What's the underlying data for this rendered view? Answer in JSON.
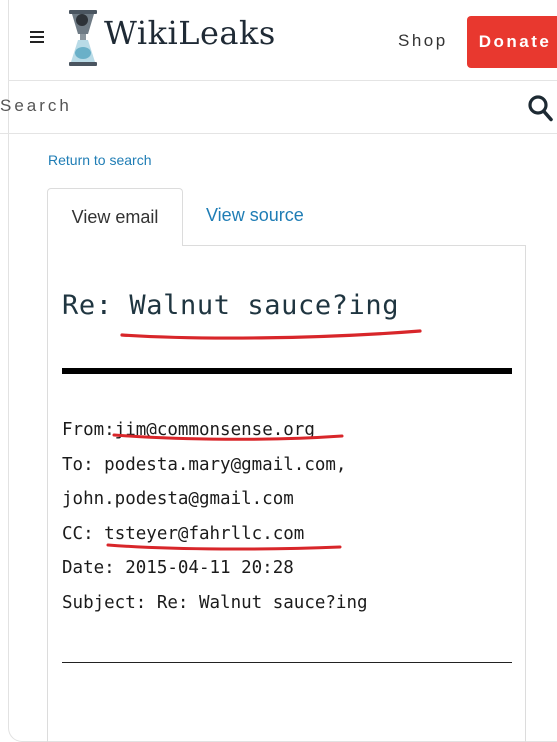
{
  "header": {
    "site_title": "WikiLeaks",
    "shop_label": "Shop",
    "donate_label": "Donate"
  },
  "search": {
    "placeholder": "Search"
  },
  "return_link": "Return to search",
  "tabs": [
    {
      "label": "View email",
      "active": true
    },
    {
      "label": "View source",
      "active": false
    }
  ],
  "email": {
    "title": "Re: Walnut sauce?ing",
    "from_label": "From:",
    "from_value": "jim@commonsense.org",
    "to_line_1": "To: podesta.mary@gmail.com,",
    "to_line_2": "john.podesta@gmail.com",
    "cc_label": "CC: ",
    "cc_value": "tsteyer@fahrllc.com",
    "date_line": "Date: 2015-04-11 20:28",
    "subject_line": "Subject: Re: Walnut sauce?ing"
  },
  "colors": {
    "donate": "#e8382f",
    "link": "#1f7db5",
    "annotation": "#d8262a"
  },
  "icons": [
    "hamburger-menu-icon",
    "wikileaks-hourglass-logo",
    "search-icon"
  ]
}
